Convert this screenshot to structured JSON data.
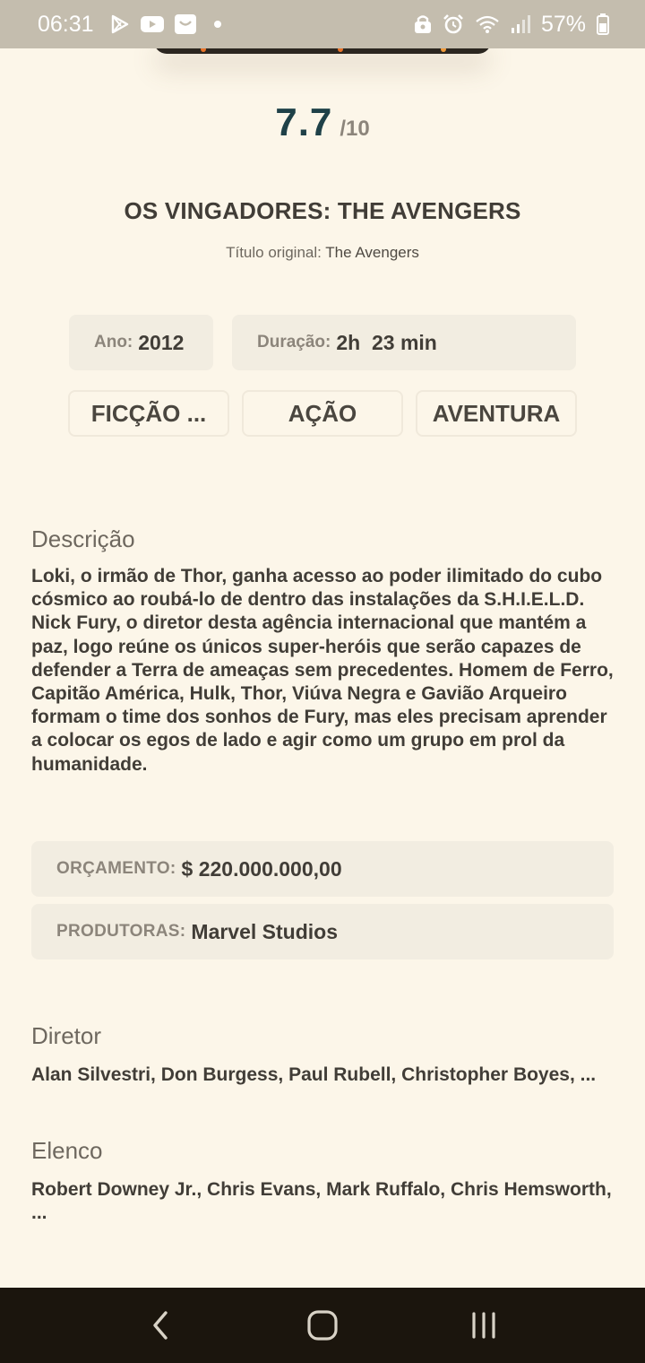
{
  "status_bar": {
    "time": "06:31",
    "battery": "57%"
  },
  "movie": {
    "rating": "7.7",
    "rating_max": "/10",
    "title": "OS VINGADORES: THE AVENGERS",
    "original_title_label": "Título original:",
    "original_title": "The Avengers",
    "year_label": "Ano:",
    "year": "2012",
    "duration_label": "Duração:",
    "duration": "2h  23 min",
    "genres": [
      "FICÇÃO ...",
      "AÇÃO",
      "AVENTURA"
    ]
  },
  "description": {
    "heading": "Descrição",
    "text": "Loki, o irmão de Thor, ganha acesso ao poder ilimitado do cubo cósmico ao roubá-lo de dentro das instalações da S.H.I.E.L.D. Nick Fury, o diretor desta agência internacional que mantém a paz, logo reúne os únicos super-heróis que serão capazes de defender a Terra de ameaças sem precedentes. Homem de Ferro, Capitão América, Hulk, Thor, Viúva Negra e Gavião Arqueiro formam o time dos sonhos de Fury, mas eles precisam aprender a colocar os egos de lado e agir como um grupo em prol da humanidade."
  },
  "details": {
    "budget_label": "ORÇAMENTO:",
    "budget": "$ 220.000.000,00",
    "producers_label": "PRODUTORAS:",
    "producers": "Marvel Studios"
  },
  "director": {
    "heading": "Diretor",
    "names": "Alan Silvestri, Don Burgess, Paul Rubell, Christopher Boyes, ..."
  },
  "cast": {
    "heading": "Elenco",
    "names": "Robert Downey Jr., Chris Evans, Mark Ruffalo, Chris Hemsworth, ..."
  },
  "icons": {
    "status_left": [
      "play-store-icon",
      "youtube-icon",
      "shopping-bag-icon",
      "notification-dot-icon"
    ],
    "status_right": [
      "lock-icon",
      "alarm-icon",
      "wifi-icon",
      "signal-icon",
      "battery-icon"
    ],
    "nav": [
      "back-icon",
      "home-icon",
      "recents-icon"
    ]
  },
  "colors": {
    "background": "#fcf6e9",
    "rating": "#1f4148",
    "box": "#f2ede1",
    "nav_bar": "#1b150d",
    "status_bar": "#c4bdae"
  }
}
